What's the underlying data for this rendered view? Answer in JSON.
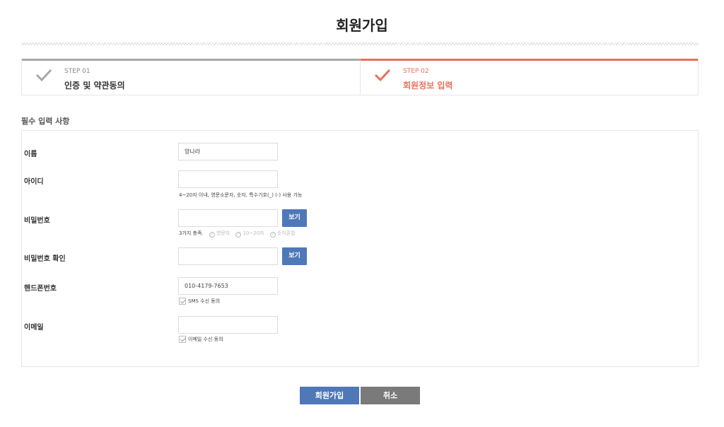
{
  "page": {
    "title": "회원가입"
  },
  "steps": [
    {
      "num": "STEP 01",
      "name": "인증 및 약관동의"
    },
    {
      "num": "STEP 02",
      "name": "회원정보 입력"
    }
  ],
  "colors": {
    "accent": "#e8705a",
    "primary": "#4f78b8",
    "secondary": "#7a7a7a",
    "inactive": "#a8a8a8"
  },
  "section": {
    "title": "필수 입력 사항"
  },
  "fields": {
    "name": {
      "label": "이름",
      "value": "양나라"
    },
    "id": {
      "label": "아이디",
      "value": "",
      "hint": "4~20자 이내, 영문소문자, 숫자, 특수기호(_) (-) 사용 가능"
    },
    "password": {
      "label": "비밀번호",
      "value": "",
      "view": "보기",
      "hint": "3가지 충족.",
      "rules": [
        "영문자",
        "10~20자",
        "숫자혼합"
      ]
    },
    "password_confirm": {
      "label": "비밀번호 확인",
      "value": "",
      "view": "보기"
    },
    "phone": {
      "label": "핸드폰번호",
      "value": "010-4179-7653",
      "consent": "SMS 수신 동의"
    },
    "email": {
      "label": "이메일",
      "value": "",
      "consent": "이메일 수신 동의"
    }
  },
  "actions": {
    "submit": "회원가입",
    "cancel": "취소"
  }
}
